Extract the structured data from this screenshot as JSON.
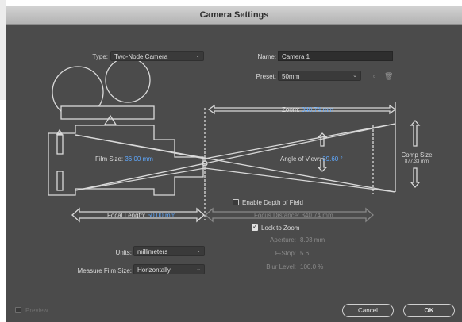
{
  "window": {
    "title": "Camera Settings"
  },
  "type_field": {
    "label": "Type:",
    "value": "Two-Node Camera"
  },
  "name_field": {
    "label": "Name:",
    "value": "Camera 1"
  },
  "preset_field": {
    "label": "Preset:",
    "value": "50mm"
  },
  "zoom": {
    "label": "Zoom:",
    "value": "340.74 mm"
  },
  "film_size": {
    "label": "Film Size:",
    "value": "36.00 mm"
  },
  "angle_of_view": {
    "label": "Angle of View:",
    "value": "39.60 °"
  },
  "comp_size": {
    "label": "Comp Size",
    "value": "877.33 mm"
  },
  "focal_length": {
    "label": "Focal Length:",
    "value": "50.00 mm"
  },
  "depth_of_field": {
    "label": "Enable Depth of Field",
    "checked": false
  },
  "focus_distance": {
    "label": "Focus Distance:",
    "value": "340.74 mm"
  },
  "lock_to_zoom": {
    "label": "Lock to Zoom",
    "checked": true
  },
  "aperture": {
    "label": "Aperture:",
    "value": "8.93 mm"
  },
  "f_stop": {
    "label": "F-Stop:",
    "value": "5.6"
  },
  "blur_level": {
    "label": "Blur Level:",
    "value": "100.0 %"
  },
  "units": {
    "label": "Units:",
    "value": "millimeters"
  },
  "measure_film_size": {
    "label": "Measure Film Size:",
    "value": "Horizontally"
  },
  "preview": {
    "label": "Preview",
    "checked": false
  },
  "buttons": {
    "cancel": "Cancel",
    "ok": "OK"
  },
  "icons": {
    "dropdown": "chevron-down-icon",
    "save_preset": "save-preset-icon",
    "delete_preset": "trash-icon"
  },
  "colors": {
    "dialog_bg": "#4b4b4b",
    "value_text": "#5fa9ff",
    "field_bg": "#2e2e2e",
    "line": "#d9d9d9"
  }
}
